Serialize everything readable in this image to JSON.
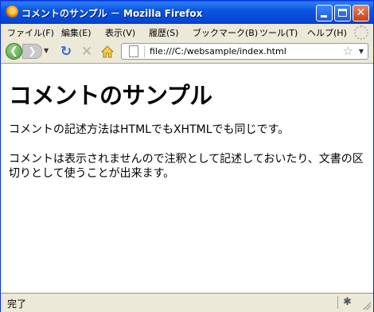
{
  "window": {
    "title": "コメントのサンプル － Mozilla Firefox",
    "app_icon": "firefox-icon"
  },
  "menu": {
    "items": [
      "ファイル(F)",
      "編集(E)",
      "表示(V)",
      "履歴(S)",
      "ブックマーク(B)",
      "ツール(T)",
      "ヘルプ(H)"
    ]
  },
  "toolbar": {
    "back_glyph": "❮",
    "forward_glyph": "❯",
    "reload_glyph": "↻",
    "stop_glyph": "✕",
    "url": "file:///C:/websample/index.html",
    "star_glyph": "☆"
  },
  "page": {
    "heading": "コメントのサンプル",
    "paragraph1": "コメントの記述方法はHTMLでもXHTMLでも同じです。",
    "paragraph2": "コメントは表示されませんので注釈として記述しておいたり、文書の区切りとして使うことが出来ます。"
  },
  "status": {
    "text": "完了"
  },
  "colors": {
    "titlebar": "#0646d4",
    "chrome": "#ece9d8",
    "accent_green": "#4a9a38"
  }
}
